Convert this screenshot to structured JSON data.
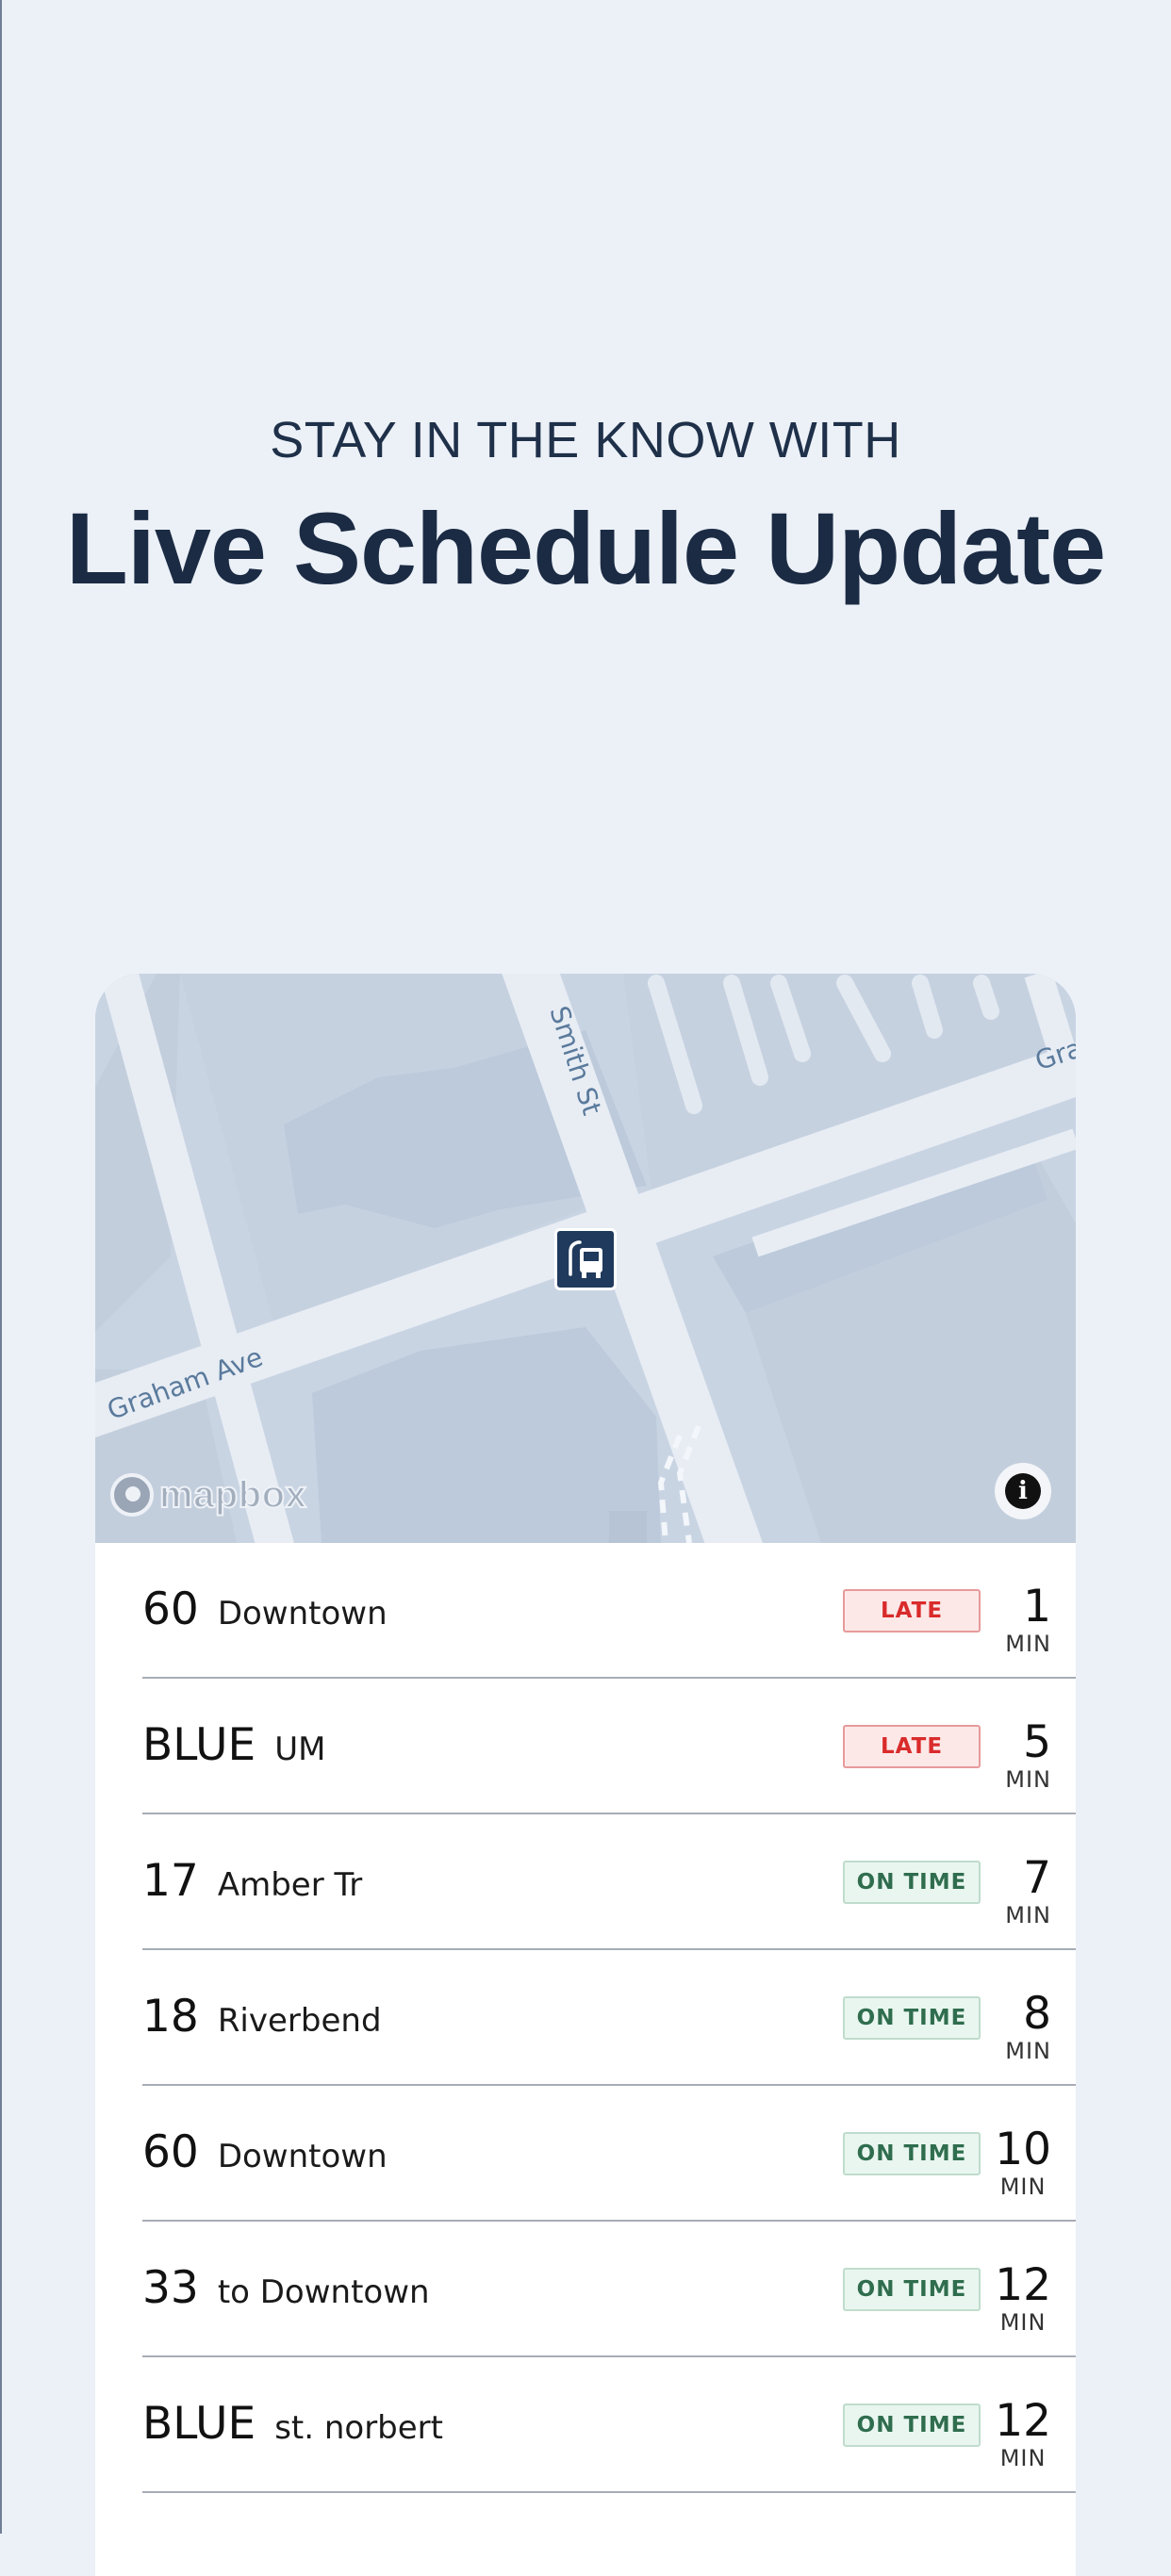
{
  "hero": {
    "kicker": "STAY IN THE KNOW WITH",
    "title": "Live Schedule Update"
  },
  "map": {
    "streets": [
      "Smith St",
      "Graham Ave",
      "Gra"
    ],
    "attribution": "mapbox",
    "marker_icon": "bus-icon",
    "info_icon": "info-icon",
    "info_glyph": "i",
    "colors": {
      "land": "#c9d4e3",
      "road": "#e8edf4",
      "building": "#bccadb",
      "marker": "#1f3a5c"
    }
  },
  "departures": [
    {
      "route": "60",
      "destination": "Downtown",
      "status": "LATE",
      "status_type": "late",
      "eta": "1",
      "unit": "MIN"
    },
    {
      "route": "BLUE",
      "destination": "UM",
      "status": "LATE",
      "status_type": "late",
      "eta": "5",
      "unit": "MIN"
    },
    {
      "route": "17",
      "destination": "Amber Tr",
      "status": "ON TIME",
      "status_type": "ontime",
      "eta": "7",
      "unit": "MIN"
    },
    {
      "route": "18",
      "destination": "Riverbend",
      "status": "ON TIME",
      "status_type": "ontime",
      "eta": "8",
      "unit": "MIN"
    },
    {
      "route": "60",
      "destination": "Downtown",
      "status": "ON TIME",
      "status_type": "ontime",
      "eta": "10",
      "unit": "MIN"
    },
    {
      "route": "33",
      "destination": "to Downtown",
      "status": "ON TIME",
      "status_type": "ontime",
      "eta": "12",
      "unit": "MIN"
    },
    {
      "route": "BLUE",
      "destination": "st. norbert",
      "status": "ON TIME",
      "status_type": "ontime",
      "eta": "12",
      "unit": "MIN"
    }
  ],
  "status_colors": {
    "late": "#d92b2b",
    "ontime": "#2f6d4e"
  }
}
